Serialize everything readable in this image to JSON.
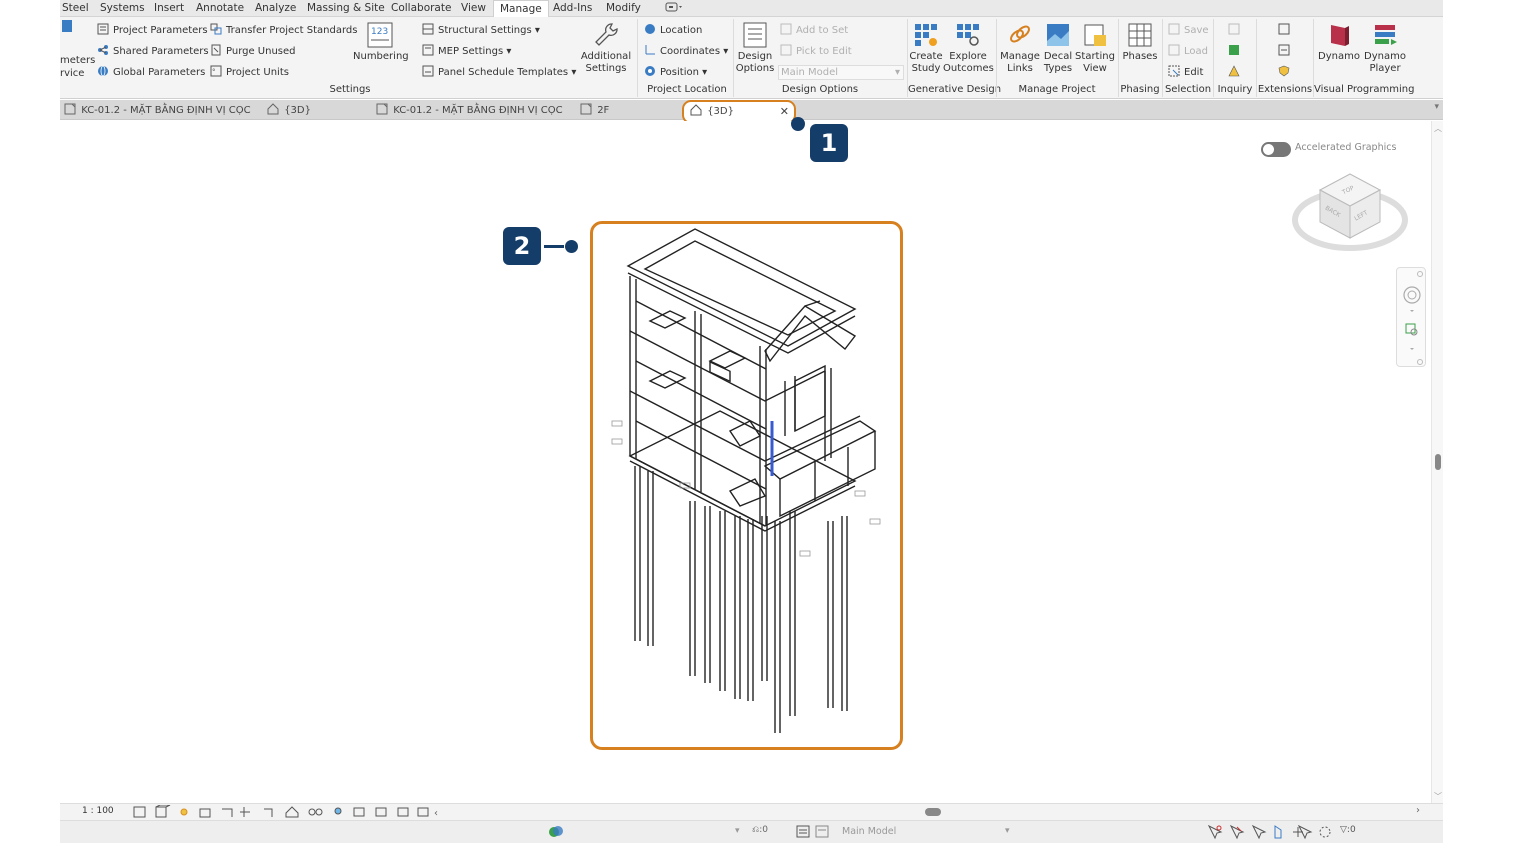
{
  "menu": [
    "Steel",
    "Systems",
    "Insert",
    "Annotate",
    "Analyze",
    "Massing & Site",
    "Collaborate",
    "View",
    "Manage",
    "Add-Ins",
    "Modify"
  ],
  "ribbon": {
    "settings": {
      "partial_top": "meters",
      "partial_bottom": "rvice",
      "project_parameters": "Project  Parameters",
      "shared_parameters": "Shared  Parameters",
      "global_parameters": "Global  Parameters",
      "transfer_standards": "Transfer  Project Standards",
      "purge_unused": "Purge  Unused",
      "project_units": "Project  Units",
      "numbering": "Numbering",
      "structural_settings": "Structural  Settings",
      "mep_settings": "MEP  Settings",
      "panel_schedule_templates": "Panel Schedule  Templates",
      "additional_settings_1": "Additional",
      "additional_settings_2": "Settings",
      "label": "Settings"
    },
    "project_location": {
      "location": "Location",
      "coordinates": "Coordinates",
      "position": "Position",
      "label": "Project Location"
    },
    "design_options": {
      "design_options_1": "Design",
      "design_options_2": "Options",
      "add_to_set": "Add to Set",
      "pick_to_edit": "Pick to Edit",
      "main_model": "Main Model",
      "label": "Design Options"
    },
    "generative_design": {
      "create_study_1": "Create",
      "create_study_2": "Study",
      "explore_outcomes_1": "Explore",
      "explore_outcomes_2": "Outcomes",
      "label": "Generative Design"
    },
    "manage_project": {
      "manage_links_1": "Manage",
      "manage_links_2": "Links",
      "decal_types_1": "Decal",
      "decal_types_2": "Types",
      "starting_view_1": "Starting",
      "starting_view_2": "View",
      "label": "Manage Project"
    },
    "phasing": {
      "phases": "Phases",
      "label": "Phasing"
    },
    "selection": {
      "save": "Save",
      "load": "Load",
      "edit": "Edit",
      "label": "Selection"
    },
    "inquiry": {
      "label": "Inquiry"
    },
    "macros": {
      "label": "Extensions"
    },
    "visual_programming": {
      "dynamo": "Dynamo",
      "dynamo_player_1": "Dynamo",
      "dynamo_player_2": "Player",
      "label": "Visual Programming"
    }
  },
  "tabs": [
    {
      "label": "KC-01.2 - MẶT BẰNG ĐỊNH VỊ CỌC"
    },
    {
      "label": "{3D}"
    },
    {
      "label": "KC-01.2 - MẶT BẰNG ĐỊNH VỊ CỌC"
    },
    {
      "label": "2F"
    },
    {
      "label": "{3D}"
    }
  ],
  "canvas": {
    "accelerated_graphics": "Accelerated Graphics",
    "viewcube": {
      "top": "TOP",
      "back": "BACK",
      "left": "LEFT"
    }
  },
  "view_control": {
    "scale": "1 : 100"
  },
  "status": {
    "zero_a": ":0",
    "main_model": "Main Model",
    "filter_count": ":0"
  },
  "callouts": {
    "one": "1",
    "two": "2"
  },
  "colors": {
    "callout_orange": "#d6801f",
    "badge_navy": "#153d69",
    "tab_bar": "#d8d8d8"
  }
}
